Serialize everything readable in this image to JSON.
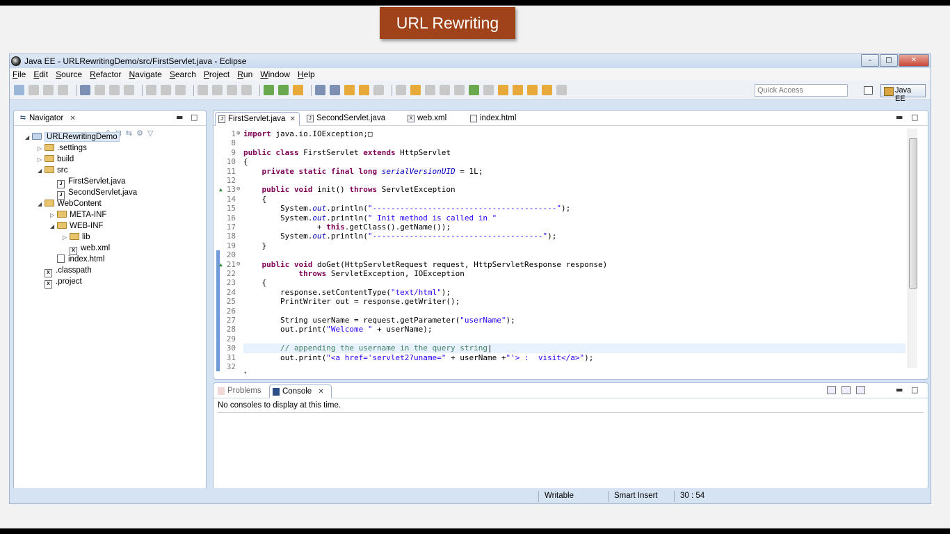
{
  "slide": {
    "title": "URL Rewriting"
  },
  "window": {
    "title": "Java EE - URLRewritingDemo/src/FirstServlet.java - Eclipse",
    "controls": {
      "minimize": "–",
      "maximize": "□",
      "close": "✕"
    }
  },
  "menu": [
    "File",
    "Edit",
    "Source",
    "Refactor",
    "Navigate",
    "Search",
    "Project",
    "Run",
    "Window",
    "Help"
  ],
  "toolbar": {
    "quick_access_placeholder": "Quick Access",
    "perspective": "Java EE"
  },
  "navigator": {
    "title": "Navigator",
    "tree": [
      {
        "label": "URLRewritingDemo",
        "type": "project",
        "depth": 0,
        "twisty": "open"
      },
      {
        "label": ".settings",
        "type": "folder",
        "depth": 1,
        "twisty": "closed"
      },
      {
        "label": "build",
        "type": "folder",
        "depth": 1,
        "twisty": "closed"
      },
      {
        "label": "src",
        "type": "folder",
        "depth": 1,
        "twisty": "open"
      },
      {
        "label": "FirstServlet.java",
        "type": "java",
        "depth": 2,
        "twisty": ""
      },
      {
        "label": "SecondServlet.java",
        "type": "java",
        "depth": 2,
        "twisty": ""
      },
      {
        "label": "WebContent",
        "type": "folder",
        "depth": 1,
        "twisty": "open"
      },
      {
        "label": "META-INF",
        "type": "folder",
        "depth": 2,
        "twisty": "closed"
      },
      {
        "label": "WEB-INF",
        "type": "folder",
        "depth": 2,
        "twisty": "open"
      },
      {
        "label": "lib",
        "type": "folder",
        "depth": 3,
        "twisty": "closed"
      },
      {
        "label": "web.xml",
        "type": "xml",
        "depth": 3,
        "twisty": ""
      },
      {
        "label": "index.html",
        "type": "html",
        "depth": 2,
        "twisty": ""
      },
      {
        "label": ".classpath",
        "type": "xml",
        "depth": 1,
        "twisty": ""
      },
      {
        "label": ".project",
        "type": "xml",
        "depth": 1,
        "twisty": ""
      }
    ]
  },
  "editor": {
    "tabs": [
      {
        "label": "FirstServlet.java",
        "active": true,
        "icon": "J"
      },
      {
        "label": "SecondServlet.java",
        "active": false,
        "icon": "J"
      },
      {
        "label": "web.xml",
        "active": false,
        "icon": "X"
      },
      {
        "label": "index.html",
        "active": false,
        "icon": ""
      }
    ],
    "lines": [
      {
        "n": "1",
        "fold": "⊕",
        "text": "<span class=\"kw\">import</span> java.io.IOException;□"
      },
      {
        "n": "8",
        "fold": "",
        "text": ""
      },
      {
        "n": "9",
        "fold": "",
        "text": "<span class=\"kw\">public class</span> FirstServlet <span class=\"kw\">extends</span> HttpServlet"
      },
      {
        "n": "10",
        "fold": "",
        "text": "{"
      },
      {
        "n": "11",
        "fold": "",
        "text": "    <span class=\"kw\">private static final long</span> <span class=\"fld\">serialVersionUID</span> = 1L;"
      },
      {
        "n": "12",
        "fold": "",
        "text": ""
      },
      {
        "n": "13",
        "fold": "⊖",
        "mark": "▲",
        "text": "    <span class=\"kw\">public void</span> init() <span class=\"kw\">throws</span> ServletException"
      },
      {
        "n": "14",
        "fold": "",
        "text": "    {"
      },
      {
        "n": "15",
        "fold": "",
        "text": "        System.<span class=\"fld\">out</span>.println(<span class=\"str\">\"----------------------------------------\"</span>);"
      },
      {
        "n": "16",
        "fold": "",
        "text": "        System.<span class=\"fld\">out</span>.println(<span class=\"str\">\" Init method is called in \"</span>"
      },
      {
        "n": "17",
        "fold": "",
        "text": "                + <span class=\"kw\">this</span>.getClass().getName());"
      },
      {
        "n": "18",
        "fold": "",
        "text": "        System.<span class=\"fld\">out</span>.println(<span class=\"str\">\"-------------------------------------\"</span>);"
      },
      {
        "n": "19",
        "fold": "",
        "text": "    }"
      },
      {
        "n": "20",
        "fold": "",
        "text": ""
      },
      {
        "n": "21",
        "fold": "⊖",
        "mark": "▲",
        "text": "    <span class=\"kw\">public void</span> doGet(HttpServletRequest request, HttpServletResponse response)"
      },
      {
        "n": "22",
        "fold": "",
        "text": "            <span class=\"kw\">throws</span> ServletException, IOException"
      },
      {
        "n": "23",
        "fold": "",
        "text": "    {"
      },
      {
        "n": "24",
        "fold": "",
        "text": "        response.setContentType(<span class=\"str\">\"text/html\"</span>);"
      },
      {
        "n": "25",
        "fold": "",
        "text": "        PrintWriter out = response.getWriter();"
      },
      {
        "n": "26",
        "fold": "",
        "text": ""
      },
      {
        "n": "27",
        "fold": "",
        "text": "        String userName = request.getParameter(<span class=\"str\">\"userName\"</span>);"
      },
      {
        "n": "28",
        "fold": "",
        "text": "        out.print(<span class=\"str\">\"Welcome \"</span> + userName);"
      },
      {
        "n": "29",
        "fold": "",
        "text": ""
      },
      {
        "n": "30",
        "fold": "",
        "current": true,
        "text": "        <span class=\"cmt\">// appending the username in the query string</span>|"
      },
      {
        "n": "31",
        "fold": "",
        "text": "        out.print(<span class=\"str\">\"&lt;a href='servlet2?uname=\"</span> + userName +<span class=\"str\">\"'&gt; :  visit&lt;/a&gt;\"</span>);"
      },
      {
        "n": "32",
        "fold": "",
        "text": ""
      }
    ]
  },
  "console": {
    "tabs": [
      {
        "label": "Problems",
        "active": false
      },
      {
        "label": "Console",
        "active": true
      }
    ],
    "message": "No consoles to display at this time."
  },
  "status": {
    "writable": "Writable",
    "insert_mode": "Smart Insert",
    "position": "30 : 54"
  },
  "colors": {
    "titlebar": "#c9d9ee",
    "slide_title_bg": "#a0431b",
    "keyword": "#7f0055",
    "string": "#2a00ff",
    "comment": "#3f7f5f"
  }
}
